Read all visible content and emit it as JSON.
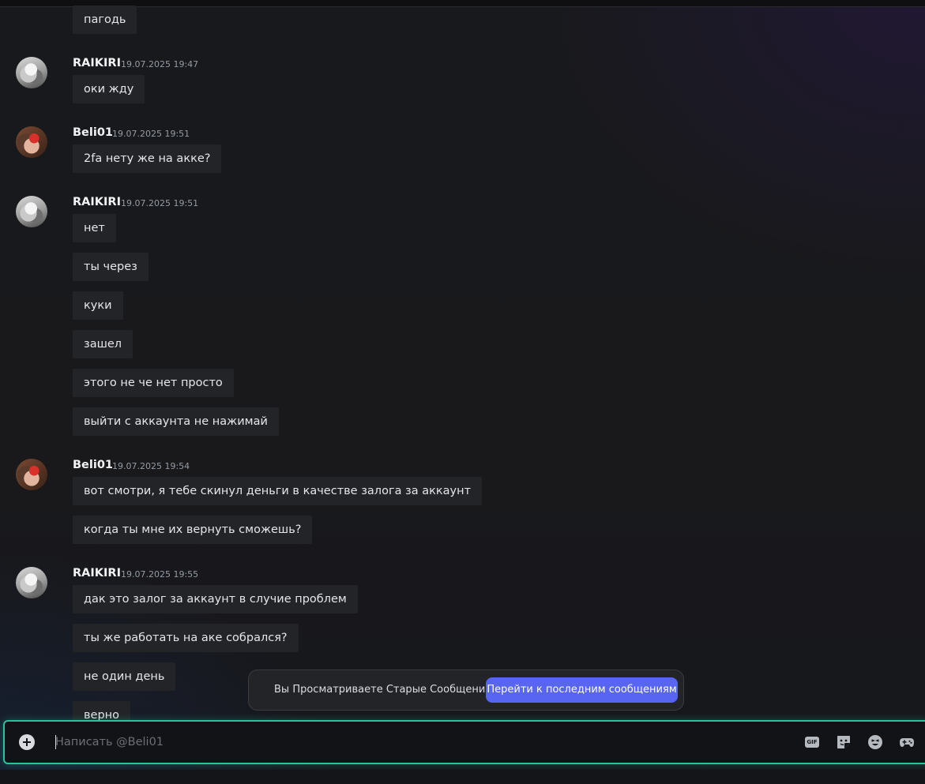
{
  "messages": {
    "first": "пагодь",
    "group1": {
      "author": "RAIKIRI",
      "timestamp": "19.07.2025 19:47",
      "lines": [
        "оки жду"
      ]
    },
    "group2": {
      "author": "Beli01",
      "timestamp": "19.07.2025 19:51",
      "lines": [
        "2fa нету же на акке?"
      ]
    },
    "group3": {
      "author": "RAIKIRI",
      "timestamp": "19.07.2025 19:51",
      "lines": [
        "нет",
        "ты через",
        "куки",
        "зашел",
        "этого не че нет просто",
        "выйти с аккаунта не нажимай"
      ]
    },
    "group4": {
      "author": "Beli01",
      "timestamp": "19.07.2025 19:54",
      "lines": [
        "вот смотри, я тебе скинул деньги в качестве залога за аккаунт",
        "когда ты мне их вернуть сможешь?"
      ]
    },
    "group5": {
      "author": "RAIKIRI",
      "timestamp": "19.07.2025 19:55",
      "lines": [
        "дак это залог за аккаунт в случие проблем",
        "ты же работать на аке собрался?",
        "не один день",
        "верно"
      ]
    }
  },
  "old_messages_bar": {
    "text": "Вы Просматриваете Старые Сообщения",
    "jump_label": "Перейти к последним сообщениям"
  },
  "composer": {
    "placeholder": "Написать @Beli01",
    "gif_label": "GIF",
    "icons": [
      "plus-circle-icon",
      "gif-icon",
      "sticker-icon",
      "emoji-icon",
      "gamepad-icon"
    ]
  },
  "colors": {
    "accent": "#5865f2",
    "composer_border": "#27c39a",
    "bubble": "#232428"
  }
}
